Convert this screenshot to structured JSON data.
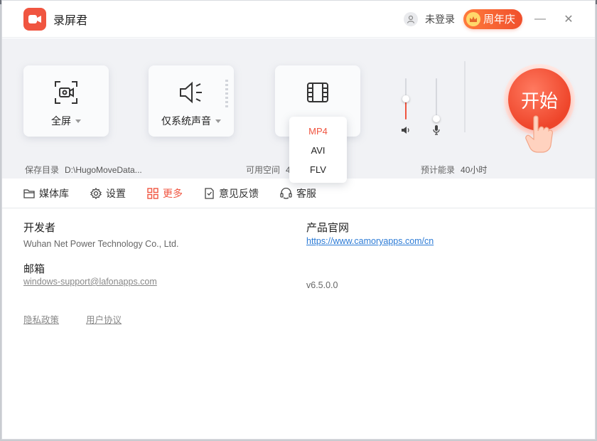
{
  "title_bar": {
    "app_name": "录屏君",
    "login_text": "未登录",
    "anniversary_badge": "周年庆",
    "minimize_symbol": "—",
    "close_symbol": "✕"
  },
  "controls": {
    "screen_card": {
      "label": "全屏",
      "icon": "screen-capture-icon"
    },
    "audio_card": {
      "label": "仅系统声音",
      "icon": "speaker-icon"
    },
    "format_card": {
      "icon": "film-icon"
    },
    "format_menu": {
      "options": [
        "MP4",
        "AVI",
        "FLV"
      ],
      "selected": "MP4"
    },
    "system_volume": {
      "level": 0.5,
      "icon": "speaker-small-icon"
    },
    "mic_volume": {
      "level": 0.0,
      "icon": "microphone-icon"
    },
    "start_button": {
      "label": "开始",
      "accent": "#ee452a"
    }
  },
  "info": {
    "save_dir_label": "保存目录",
    "save_dir_value": "D:\\HugoMoveData...",
    "free_space_label": "可用空间",
    "free_space_value": "4",
    "est_record_label": "预计能录",
    "est_record_value": "40小时"
  },
  "tabs": [
    {
      "label": "媒体库",
      "icon": "folder-icon"
    },
    {
      "label": "设置",
      "icon": "gear-icon"
    },
    {
      "label": "更多",
      "icon": "grid-icon"
    },
    {
      "label": "意见反馈",
      "icon": "feedback-icon"
    },
    {
      "label": "客服",
      "icon": "headset-icon"
    }
  ],
  "active_tab": "更多",
  "about": {
    "developer_heading": "开发者",
    "developer_value": "Wuhan Net Power Technology Co., Ltd.",
    "email_heading": "邮箱",
    "email_value": "windows-support@lafonapps.com",
    "website_heading": "产品官网",
    "website_value": "https://www.camoryapps.com/cn",
    "version": "v6.5.0.0",
    "privacy_link": "隐私政策",
    "user_agreement_link": "用户协议"
  },
  "colors": {
    "accent": "#f05540",
    "link": "#2c7bd6"
  }
}
